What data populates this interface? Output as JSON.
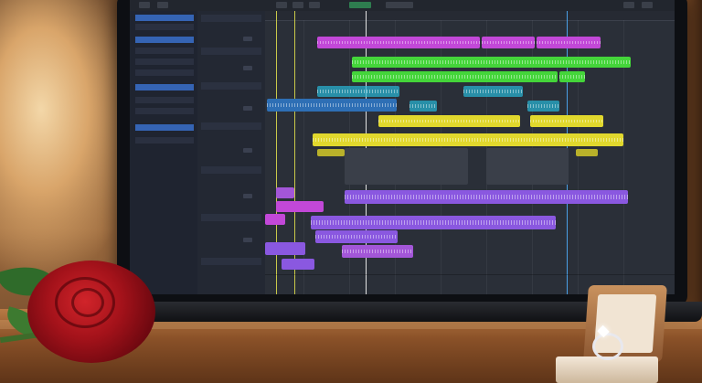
{
  "scene": {
    "colors": {
      "table": "#8a5128",
      "rose": "#a3121a",
      "screen_bg": "#1b1f27",
      "playhead": "#d6d83a",
      "clip_purple": "#9b3fd6",
      "clip_green": "#3fd63a",
      "clip_cyan": "#2ec9d9",
      "clip_yellow": "#d9d42a",
      "clip_violet": "#7a4ad9"
    }
  },
  "daw": {
    "tracks": [
      {
        "color": "#c248d8",
        "icon": "audio-track-icon"
      },
      {
        "color": "#44d53a",
        "icon": "audio-track-icon"
      },
      {
        "color": "#28b8d8",
        "icon": "audio-track-icon"
      },
      {
        "color": "#e1d82d",
        "icon": "audio-track-icon"
      },
      {
        "color": "#8a58e0",
        "icon": "midi-track-icon"
      }
    ]
  }
}
